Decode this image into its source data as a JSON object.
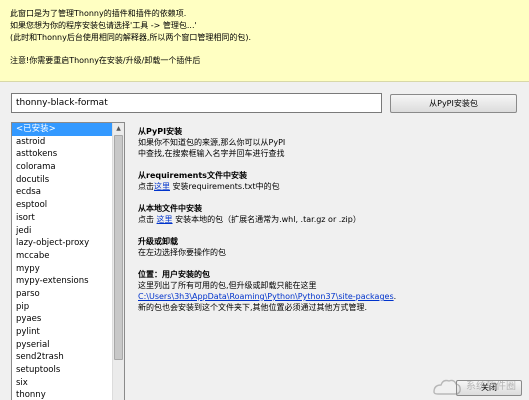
{
  "notice": {
    "line1": "此窗口是为了管理Thonny的插件和插件的依赖项.",
    "line2": "如果您想为你的程序安装包请选择'工具 -> 管理包...'",
    "line3": "(此时和Thonny后台使用相同的解释器,所以两个窗口管理相同的包).",
    "warning": "注意!你需要重启Thonny在安装/升级/卸载一个插件后"
  },
  "search": {
    "value": "thonny-black-format",
    "button_label": "从PyPI安装包"
  },
  "package_list": {
    "items": [
      "<已安装>",
      "astroid",
      "asttokens",
      "colorama",
      "docutils",
      "ecdsa",
      "esptool",
      "isort",
      "jedi",
      "lazy-object-proxy",
      "mccabe",
      "mypy",
      "mypy-extensions",
      "parso",
      "pip",
      "pyaes",
      "pylint",
      "pyserial",
      "send2trash",
      "setuptools",
      "six",
      "thonny"
    ],
    "selected_index": 0
  },
  "info": {
    "pypi": {
      "title": "从PyPI安装",
      "line1": "如果你不知道包的来源,那么你可以从PyPI",
      "line2": "中查找,在搜索框输入名字并回车进行查找"
    },
    "requirements": {
      "title": "从requirements文件中安装",
      "prefix": "点击",
      "link": "这里",
      "suffix": " 安装requirements.txt中的包"
    },
    "local": {
      "title": "从本地文件中安装",
      "prefix": "点击 ",
      "link": "这里",
      "suffix": " 安装本地的包（扩展名通常为.whl, .tar.gz or .zip）"
    },
    "upgrade": {
      "title": "升级或卸载",
      "line1": "在左边选择你要操作的包"
    },
    "location": {
      "title": "位置：用户安装的包",
      "line1": "这里列出了所有可用的包,但升级或卸载只能在这里",
      "path": "C:\\Users\\3h3\\AppData\\Roaming\\Python\\Python37\\site-packages",
      "path_suffix": ".",
      "line3": "新的包也会安装到这个文件夹下,其他位置必须通过其他方式管理."
    }
  },
  "footer": {
    "close_label": "关闭"
  },
  "watermark": {
    "text": "系统软件圈",
    "icon": "cloud-icon"
  }
}
